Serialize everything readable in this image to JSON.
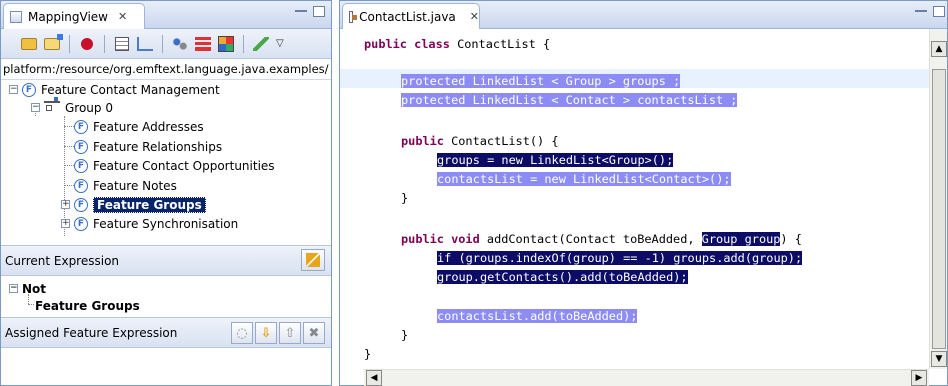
{
  "mapping_view": {
    "tab_title": "MappingView",
    "path": "platform:/resource/org.emftext.language.java.examples/",
    "tree": {
      "root": "Feature Contact Management",
      "group": "Group 0",
      "features": [
        "Feature Addresses",
        "Feature Relationships",
        "Feature Contact Opportunities",
        "Feature Notes",
        "Feature Groups",
        "Feature Synchronisation"
      ],
      "selected": "Feature Groups"
    },
    "current_expression": {
      "title": "Current Expression",
      "operator": "Not",
      "operand": "Feature Groups"
    },
    "assigned": {
      "title": "Assigned Feature Expression"
    }
  },
  "editor": {
    "tab_title": "ContactList.java",
    "code": {
      "l0_kw": "public class",
      "l0_rest": " ContactList {",
      "l2": "protected LinkedList < Group > groups ;",
      "l3": "protected LinkedList < Contact > contactsList ;",
      "l5_kw": "public",
      "l5_rest": " ContactList() {",
      "l6": "groups = new LinkedList<Group>();",
      "l7": "contactsList = new LinkedList<Contact>();",
      "l8": "}",
      "l10_kw": "public void",
      "l10_rest": " addContact(Contact toBeAdded, ",
      "l10_hl": "Group group",
      "l10_end": ") {",
      "l11": "if (groups.indexOf(group) == -1) groups.add(group);",
      "l12": "group.getContacts().add(toBeAdded);",
      "l14": "contactsList.add(toBeAdded);",
      "l15": "}",
      "l16": "}"
    }
  }
}
